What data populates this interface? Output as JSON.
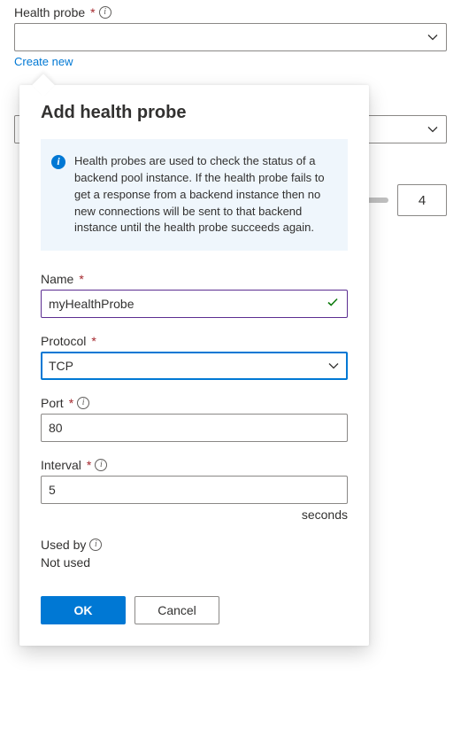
{
  "topField": {
    "label": "Health probe",
    "value": "",
    "createLink": "Create new"
  },
  "bgDropdownValue": "",
  "bgNumber": "4",
  "flyout": {
    "title": "Add health probe",
    "infoText": "Health probes are used to check the status of a backend pool instance. If the health probe fails to get a response from a backend instance then no new connections will be sent to that backend instance until the health probe succeeds again.",
    "name": {
      "label": "Name",
      "value": "myHealthProbe"
    },
    "protocol": {
      "label": "Protocol",
      "value": "TCP"
    },
    "port": {
      "label": "Port",
      "value": "80"
    },
    "interval": {
      "label": "Interval",
      "value": "5",
      "unit": "seconds"
    },
    "usedBy": {
      "label": "Used by",
      "value": "Not used"
    },
    "buttons": {
      "ok": "OK",
      "cancel": "Cancel"
    }
  }
}
